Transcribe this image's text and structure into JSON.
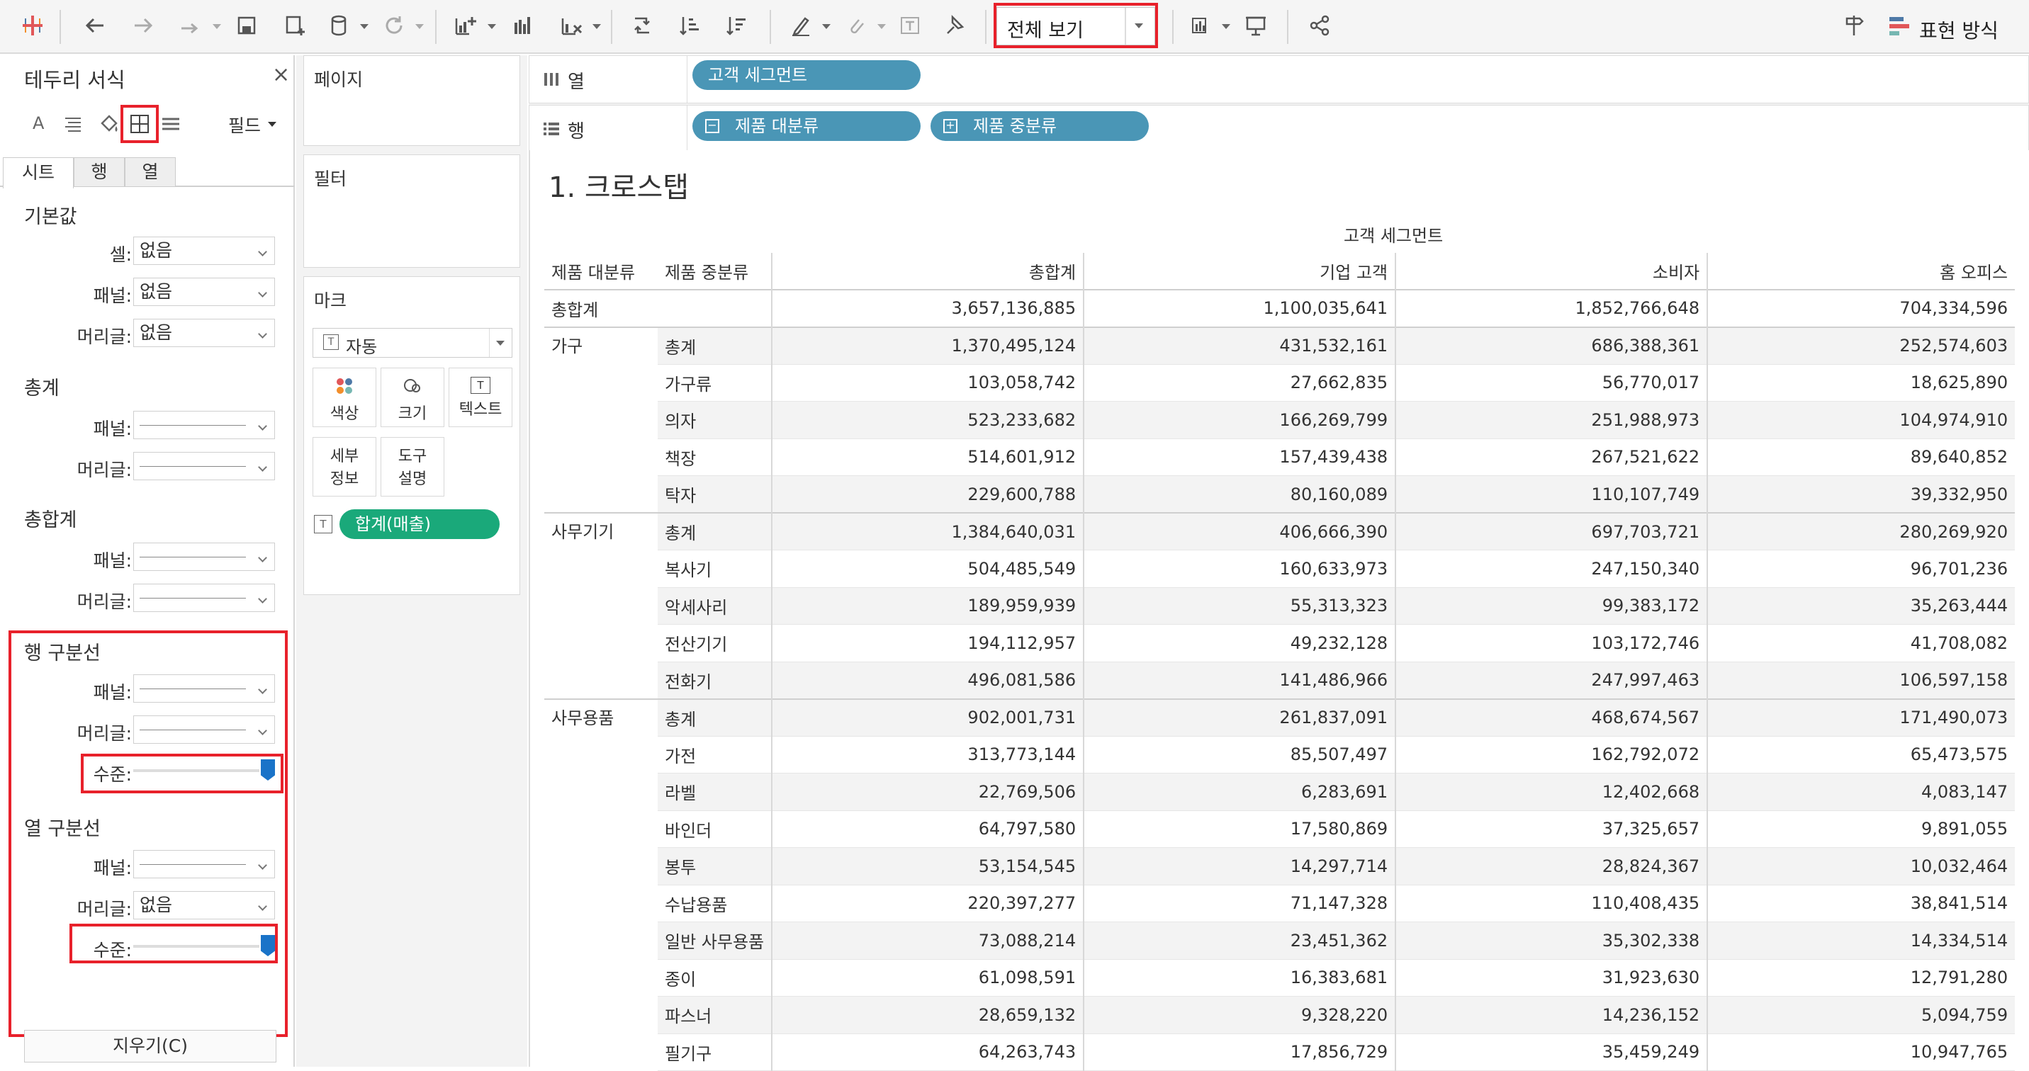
{
  "toolbar": {
    "view_select": "전체 보기",
    "show_me": "표현 방식"
  },
  "format_panel": {
    "title": "테두리 서식",
    "fields_label": "필드",
    "tabs": [
      "시트",
      "행",
      "열"
    ],
    "default_section": {
      "title": "기본값",
      "rows": [
        {
          "label": "셀:",
          "value": "없음"
        },
        {
          "label": "패널:",
          "value": "없음"
        },
        {
          "label": "머리글:",
          "value": "없음"
        }
      ]
    },
    "totals_section": {
      "title": "총계",
      "rows": [
        {
          "label": "패널:"
        },
        {
          "label": "머리글:"
        }
      ]
    },
    "grand_totals_section": {
      "title": "총합계",
      "rows": [
        {
          "label": "패널:"
        },
        {
          "label": "머리글:"
        }
      ]
    },
    "row_divider": {
      "title": "행 구분선",
      "panel_label": "패널:",
      "header_label": "머리글:",
      "level_label": "수준:",
      "level_value": 1.0
    },
    "column_divider": {
      "title": "열 구분선",
      "panel_label": "패널:",
      "header_label": "머리글:",
      "header_value": "없음",
      "level_label": "수준:",
      "level_value": 1.0
    },
    "clear_button": "지우기(C)"
  },
  "cards": {
    "pages": "페이지",
    "filters": "필터",
    "marks": "마크",
    "mark_type": "자동",
    "buttons": {
      "color": "색상",
      "size": "크기",
      "text": "텍스트",
      "detail_1": "세부",
      "detail_2": "정보",
      "tooltip_1": "도구",
      "tooltip_2": "설명"
    },
    "measure_pill": "합계(매출)"
  },
  "shelves": {
    "columns_label": "열",
    "rows_label": "행",
    "columns_pill": "고객 세그먼트",
    "rows_pills": [
      "제품 대분류",
      "제품 중분류"
    ]
  },
  "view": {
    "title": "1. 크로스탭",
    "column_group_header": "고객 세그먼트",
    "headers": [
      "제품 대분류",
      "제품 중분류",
      "총합계",
      "기업 고객",
      "소비자",
      "홈 오피스"
    ],
    "grand_total_label": "총합계",
    "grand_total_values": [
      "3,657,136,885",
      "1,100,035,641",
      "1,852,766,648",
      "704,334,596"
    ],
    "groups": [
      {
        "name": "가구",
        "rows": [
          {
            "sub": "총계",
            "v": [
              "1,370,495,124",
              "431,532,161",
              "686,388,361",
              "252,574,603"
            ]
          },
          {
            "sub": "가구류",
            "v": [
              "103,058,742",
              "27,662,835",
              "56,770,017",
              "18,625,890"
            ]
          },
          {
            "sub": "의자",
            "v": [
              "523,233,682",
              "166,269,799",
              "251,988,973",
              "104,974,910"
            ]
          },
          {
            "sub": "책장",
            "v": [
              "514,601,912",
              "157,439,438",
              "267,521,622",
              "89,640,852"
            ]
          },
          {
            "sub": "탁자",
            "v": [
              "229,600,788",
              "80,160,089",
              "110,107,749",
              "39,332,950"
            ]
          }
        ]
      },
      {
        "name": "사무기기",
        "rows": [
          {
            "sub": "총계",
            "v": [
              "1,384,640,031",
              "406,666,390",
              "697,703,721",
              "280,269,920"
            ]
          },
          {
            "sub": "복사기",
            "v": [
              "504,485,549",
              "160,633,973",
              "247,150,340",
              "96,701,236"
            ]
          },
          {
            "sub": "악세사리",
            "v": [
              "189,959,939",
              "55,313,323",
              "99,383,172",
              "35,263,444"
            ]
          },
          {
            "sub": "전산기기",
            "v": [
              "194,112,957",
              "49,232,128",
              "103,172,746",
              "41,708,082"
            ]
          },
          {
            "sub": "전화기",
            "v": [
              "496,081,586",
              "141,486,966",
              "247,997,463",
              "106,597,158"
            ]
          }
        ]
      },
      {
        "name": "사무용품",
        "rows": [
          {
            "sub": "총계",
            "v": [
              "902,001,731",
              "261,837,091",
              "468,674,567",
              "171,490,073"
            ]
          },
          {
            "sub": "가전",
            "v": [
              "313,773,144",
              "85,507,497",
              "162,792,072",
              "65,473,575"
            ]
          },
          {
            "sub": "라벨",
            "v": [
              "22,769,506",
              "6,283,691",
              "12,402,668",
              "4,083,147"
            ]
          },
          {
            "sub": "바인더",
            "v": [
              "64,797,580",
              "17,580,869",
              "37,325,657",
              "9,891,055"
            ]
          },
          {
            "sub": "봉투",
            "v": [
              "53,154,545",
              "14,297,714",
              "28,824,367",
              "10,032,464"
            ]
          },
          {
            "sub": "수납용품",
            "v": [
              "220,397,277",
              "71,147,328",
              "110,408,435",
              "38,841,514"
            ]
          },
          {
            "sub": "일반 사무용품",
            "v": [
              "73,088,214",
              "23,451,362",
              "35,302,338",
              "14,334,514"
            ]
          },
          {
            "sub": "종이",
            "v": [
              "61,098,591",
              "16,383,681",
              "31,923,630",
              "12,791,280"
            ]
          },
          {
            "sub": "파스너",
            "v": [
              "28,659,132",
              "9,328,220",
              "14,236,152",
              "5,094,759"
            ]
          },
          {
            "sub": "필기구",
            "v": [
              "64,263,743",
              "17,856,729",
              "35,459,249",
              "10,947,765"
            ]
          }
        ]
      }
    ]
  },
  "colors": {
    "highlight": "#e8212b",
    "pill_blue": "#4a96b6",
    "pill_green": "#1aa97a",
    "slider": "#1a73c8"
  }
}
